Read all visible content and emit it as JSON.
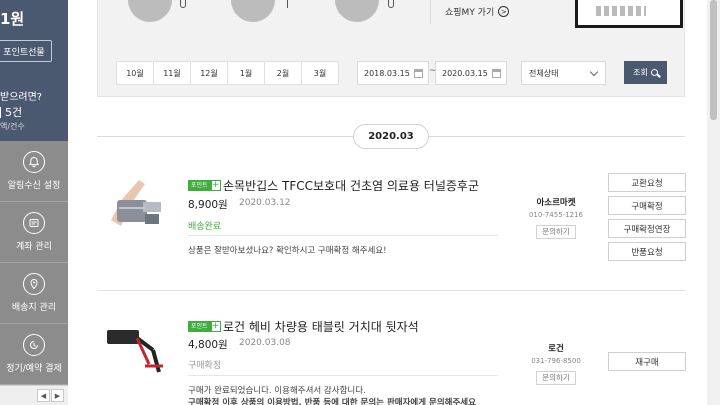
{
  "sidebar": {
    "points": "1원",
    "gift_button": "포인트선물",
    "question": "받으려면?",
    "count": "5건",
    "count_label": "액/건수",
    "menu": [
      {
        "label": "알림수신 설정",
        "icon": "bell-icon"
      },
      {
        "label": "계좌 관리",
        "icon": "card-icon"
      },
      {
        "label": "배송지 관리",
        "icon": "location-pin-icon"
      },
      {
        "label": "정기/예약 결제",
        "icon": "clock-refresh-icon"
      }
    ],
    "pager_prev": "◀",
    "pager_next": "▶"
  },
  "filter": {
    "myshop_link": "쇼핑MY 가기",
    "months": [
      "10월",
      "11월",
      "12월",
      "1월",
      "2월",
      "3월"
    ],
    "date_from": "2018.03.15",
    "date_to": "2020.03.15",
    "tilde": "~",
    "status": "전체상태",
    "search": "조회"
  },
  "section_date": "2020.03",
  "orders": [
    {
      "badge": "포인트",
      "name": "손목반깁스 TFCC보호대 건초염 의료용 터널증후군",
      "price": "8,900원",
      "date": "2020.03.12",
      "status": "배송완료",
      "message": "상품은 잘받아보셨나요? 확인하시고 구매확정 해주세요!",
      "seller": "아소르마켓",
      "phone": "010-7455-1216",
      "ask": "문의하기",
      "actions": [
        "교환요청",
        "구매확정",
        "구매확정연장",
        "반품요청"
      ]
    },
    {
      "badge": "포인트",
      "name": "로건 헤비 차량용 태블릿 거치대 뒷자석",
      "price": "4,800원",
      "date": "2020.03.08",
      "status": "구매확정",
      "message": "구매가 완료되었습니다. 이용해주셔서 감사합니다.",
      "message2": "구매확정 이후 상품의 이용방법, 반품 등에 대한 문의는 판매자에게 문의해주세요",
      "seller": "로건",
      "phone": "031-796-8500",
      "ask": "문의하기",
      "actions": [
        "재구매"
      ]
    }
  ],
  "colors": {
    "navy": "#4b5970",
    "green": "#3fae3f",
    "sidebar_gray": "#8c8c8c"
  }
}
